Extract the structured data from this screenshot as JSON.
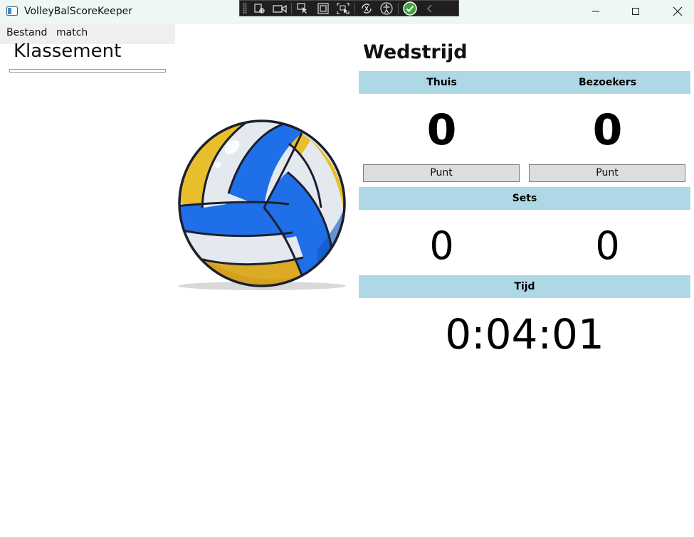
{
  "window": {
    "title": "VolleyBalScoreKeeper"
  },
  "menu": {
    "items": [
      {
        "label": "Bestand"
      },
      {
        "label": "match"
      }
    ]
  },
  "klassement": {
    "title": "Klassement"
  },
  "wedstrijd": {
    "title": "Wedstrijd",
    "home_label": "Thuis",
    "away_label": "Bezoekers",
    "home_score": "0",
    "away_score": "0",
    "point_button_home": "Punt",
    "point_button_away": "Punt",
    "sets_label": "Sets",
    "home_sets": "0",
    "away_sets": "0",
    "time_label": "Tijd",
    "time_value": "0:04:01"
  },
  "colors": {
    "header_band": "#aed8e6",
    "button_bg": "#dddddd",
    "ball_blue": "#1f6fe8",
    "ball_yellow": "#e8bf2b",
    "ball_white": "#e4e9f0"
  },
  "icons": {
    "app": "app-window-icon",
    "debug_toolbar": [
      "select-element-icon",
      "record-icon",
      "pointer-icon",
      "layout-adorner-icon",
      "track-focus-icon",
      "hot-reload-icon",
      "accessibility-icon",
      "binding-check-icon",
      "collapse-icon"
    ]
  }
}
